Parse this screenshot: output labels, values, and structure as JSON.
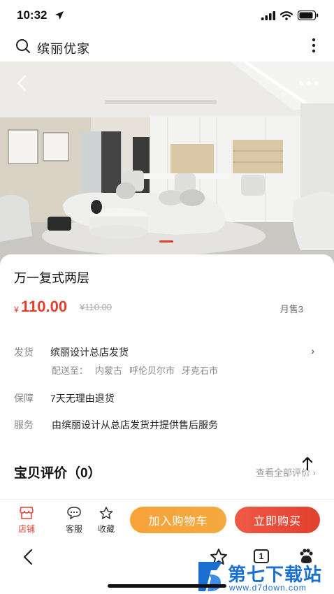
{
  "status_bar": {
    "time": "10:32",
    "icons": [
      "location-arrow-icon",
      "signal-icon",
      "wifi-icon",
      "battery-icon"
    ]
  },
  "header": {
    "search_icon": "search-icon",
    "title": "缤丽优家",
    "more_icon": "more-vertical-icon"
  },
  "hero": {
    "image_desc_icon": "living-room-photo",
    "back_icon": "chevron-left-icon",
    "more_icon": "more-horizontal-icon",
    "active_slide": 1
  },
  "product": {
    "title": "万一复式两层",
    "currency": "¥",
    "price": "110.00",
    "original_price": "¥110.00",
    "monthly_sales": "月售3"
  },
  "info": {
    "shipping_label": "发货",
    "shipping_value": "缤丽设计总店发货",
    "delivery_prefix": "配送至：",
    "delivery_province": "内蒙古",
    "delivery_city": "呼伦贝尔市",
    "delivery_district": "牙克石市",
    "guarantee_label": "保障",
    "guarantee_value": "7天无理由退货",
    "service_label": "服务",
    "service_value": "由缤丽设计从总店发货并提供售后服务"
  },
  "reviews": {
    "title": "宝贝评价（0）",
    "view_all": "查看全部评价"
  },
  "action_bar": {
    "store_label": "店铺",
    "service_label": "客服",
    "favorite_label": "收藏",
    "add_to_cart": "加入购物车",
    "buy_now": "立即购买"
  },
  "browser": {
    "tabs_count": "1"
  },
  "watermark": {
    "title": "第七下载站",
    "url": "www.d7down.com"
  },
  "colors": {
    "accent": "#e2402f",
    "cart_button": "#f7a23a",
    "watermark": "#1a6fd1"
  }
}
